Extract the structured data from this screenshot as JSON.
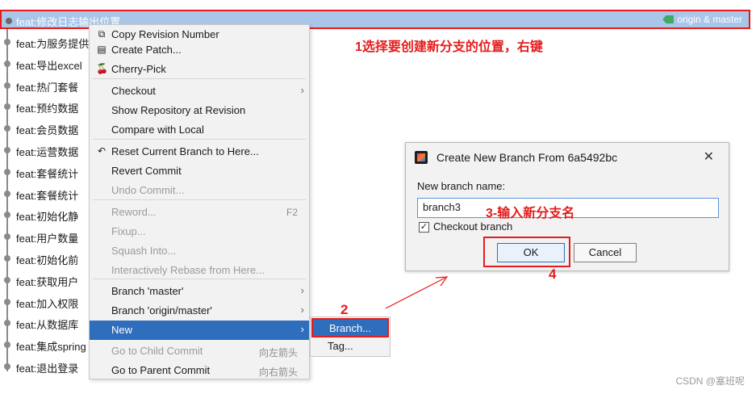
{
  "log": {
    "selected_commit": "feat:修改日志输出位置",
    "selected_refs": "origin & master",
    "commits": [
      "feat:为服务提供",
      "feat:导出excel",
      "feat:热门套餐",
      "feat:预约数据",
      "feat:会员数据",
      "feat:运营数据",
      "feat:套餐统计",
      "feat:套餐统计",
      "feat:初始化静",
      "feat:用户数量",
      "feat:初始化前",
      "feat:获取用户",
      "feat:加入权限",
      "feat:从数据库",
      "feat:集成spring",
      "feat:退出登录"
    ]
  },
  "menu": {
    "items": [
      {
        "label": "Copy Revision Number",
        "icon": "copy-icon",
        "glyph": "⧉"
      },
      {
        "label": "Create Patch...",
        "icon": "patch-icon",
        "glyph": "▤"
      },
      {
        "label": "Cherry-Pick",
        "icon": "cherry-icon",
        "glyph": "🍒"
      },
      {
        "label": "Checkout",
        "arrow": "›"
      },
      {
        "label": "Show Repository at Revision"
      },
      {
        "label": "Compare with Local"
      },
      {
        "label": "Reset Current Branch to Here...",
        "icon": "undo-icon",
        "glyph": "↶"
      },
      {
        "label": "Revert Commit"
      },
      {
        "label": "Undo Commit..."
      },
      {
        "label": "Reword...",
        "shortcut": "F2"
      },
      {
        "label": "Fixup..."
      },
      {
        "label": "Squash Into..."
      },
      {
        "label": "Interactively Rebase from Here..."
      },
      {
        "label": "Branch 'master'",
        "arrow": "›"
      },
      {
        "label": "Branch 'origin/master'",
        "arrow": "›"
      },
      {
        "label": "New",
        "arrow": "›"
      },
      {
        "label": "Go to Child Commit",
        "shortcut": "向左箭头"
      },
      {
        "label": "Go to Parent Commit",
        "shortcut": "向右箭头"
      }
    ]
  },
  "submenu": {
    "branch": "Branch...",
    "tag": "Tag..."
  },
  "dialog": {
    "title": "Create New Branch From 6a5492bc",
    "close": "✕",
    "field_label": "New branch name:",
    "branch_name": "branch3",
    "checkout_label": "Checkout branch",
    "checkout_checked": "✓",
    "ok": "OK",
    "cancel": "Cancel"
  },
  "annotations": {
    "step1": "1选择要创建新分支的位置，右键",
    "step2": "2",
    "step3": "3-输入新分支名",
    "step4": "4"
  },
  "watermark": "CSDN @塞班呢",
  "colors": {
    "selection": "#a9c5e8",
    "highlight": "#2f6ebd",
    "annotation": "#e51c1c"
  }
}
